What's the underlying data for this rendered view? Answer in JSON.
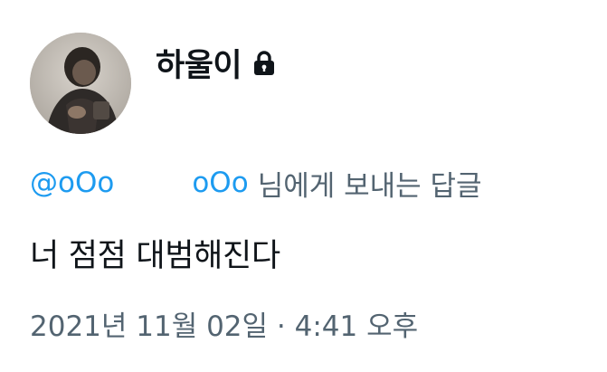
{
  "author": {
    "display_name": "하울이",
    "protected_icon": "lock-icon",
    "avatar": "avatar-photo"
  },
  "reply_context": {
    "mention_1": "@oOo",
    "mention_2": "oOo",
    "suffix": "님에게 보내는 답글"
  },
  "tweet": {
    "text": "너 점점 대범해진다",
    "date": "2021년 11월 02일",
    "separator": "·",
    "time": "4:41 오후"
  },
  "colors": {
    "link": "#1d9bf0",
    "text": "#0f1419",
    "secondary": "#536471"
  }
}
